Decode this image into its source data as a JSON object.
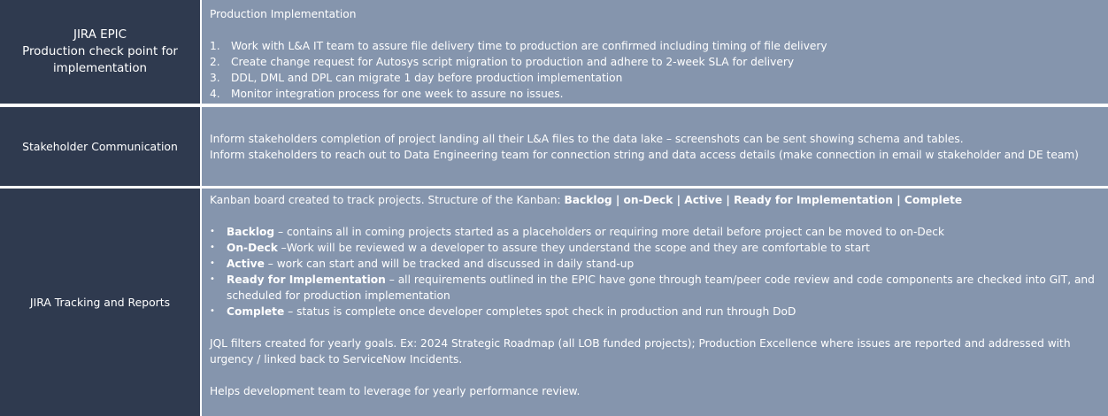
{
  "rows": [
    {
      "left_lines": [
        "JIRA EPIC",
        "Production check point for",
        "implementation"
      ],
      "heading": "Production Implementation",
      "steps": [
        {
          "num": "1.",
          "text": "Work with L&A IT team to assure file delivery time to production are confirmed including timing of file delivery"
        },
        {
          "num": "2.",
          "text": "Create change request for Autosys script migration to production and adhere to 2-week SLA for delivery"
        },
        {
          "num": "3.",
          "text": "DDL, DML and DPL can migrate 1 day before production implementation"
        },
        {
          "num": "4.",
          "text": "Monitor integration process for one week to assure no issues."
        }
      ]
    },
    {
      "left_label": "Stakeholder Communication",
      "lines": [
        "Inform stakeholders completion of project landing all their L&A files to the data lake – screenshots can be sent showing schema and tables.",
        "Inform stakeholders to reach out to Data Engineering team for connection string and data access details (make connection in email w stakeholder and DE team)"
      ]
    },
    {
      "left_label": "JIRA Tracking and Reports",
      "intro": "Kanban board created to track projects. Structure of the Kanban: ",
      "intro_bold": "Backlog | on-Deck | Active | Ready for Implementation | Complete",
      "bullets": [
        {
          "term": "Backlog",
          "text": " – contains all in coming projects started as a placeholders or requiring more detail before project can be moved to on-Deck"
        },
        {
          "term": "On-Deck",
          "text": " –Work will be reviewed w a developer to assure they understand the scope and they are comfortable to start"
        },
        {
          "term": "Active",
          "text": " –  work can start and will be tracked and discussed in daily stand-up"
        },
        {
          "term": "Ready for Implementation",
          "text": " – all requirements outlined in the EPIC have gone through team/peer code review and code components are checked into GIT, and scheduled for production implementation"
        },
        {
          "term": "Complete",
          "text": " – status is complete once developer completes spot check in production and run through DoD"
        }
      ],
      "jql": "JQL filters created for yearly goals. Ex: 2024 Strategic Roadmap (all LOB funded projects); Production Excellence where issues are reported and addressed with urgency / linked back to ServiceNow Incidents.",
      "closing": "Helps development team to leverage for yearly performance review."
    }
  ],
  "bullet_glyph": "•",
  "colors": {
    "left_cell": "#2f3a4f",
    "right_cell": "#8595ad",
    "separator": "#ffffff",
    "text": "#ffffff"
  }
}
